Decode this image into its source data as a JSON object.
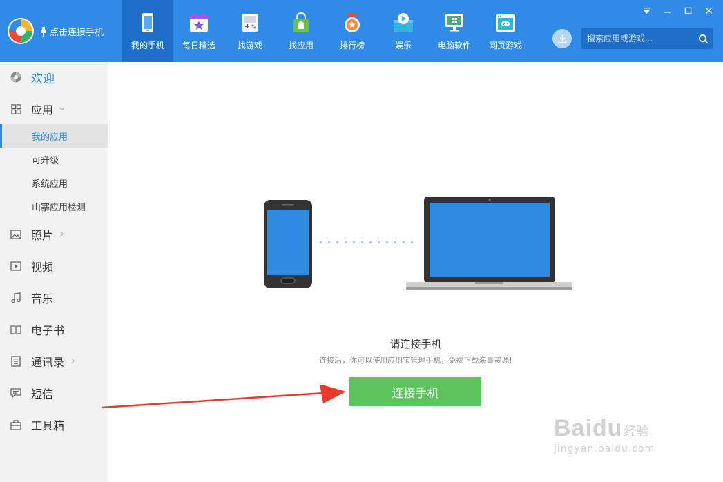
{
  "header": {
    "connect_hint": "点击连接手机",
    "nav": [
      {
        "label": "我的手机",
        "icon": "phone-icon"
      },
      {
        "label": "每日精选",
        "icon": "calendar-star-icon"
      },
      {
        "label": "找游戏",
        "icon": "gamepad-icon"
      },
      {
        "label": "找应用",
        "icon": "android-bag-icon"
      },
      {
        "label": "排行榜",
        "icon": "medal-icon"
      },
      {
        "label": "娱乐",
        "icon": "play-box-icon"
      },
      {
        "label": "电脑软件",
        "icon": "monitor-icon"
      },
      {
        "label": "网页游戏",
        "icon": "browser-game-icon"
      }
    ],
    "search_placeholder": "搜索应用或游戏..."
  },
  "sidebar": {
    "welcome": "欢迎",
    "apps": "应用",
    "apps_sub": [
      "我的应用",
      "可升级",
      "系统应用",
      "山寨应用检测"
    ],
    "photos": "照片",
    "video": "视频",
    "music": "音乐",
    "ebook": "电子书",
    "contacts": "通讯录",
    "sms": "短信",
    "toolbox": "工具箱"
  },
  "main": {
    "title": "请连接手机",
    "desc": "连接后，你可以使用应用宝管理手机，免费下载海量资源!",
    "button": "连接手机"
  },
  "watermark": {
    "logo": "Baidu",
    "text": "经验",
    "url": "jingyan.baidu.com"
  },
  "colors": {
    "brand_blue": "#2f8be5",
    "active_nav": "#1e6fcb",
    "connect_green": "#5cc45c",
    "arrow_red": "#e8392f"
  }
}
